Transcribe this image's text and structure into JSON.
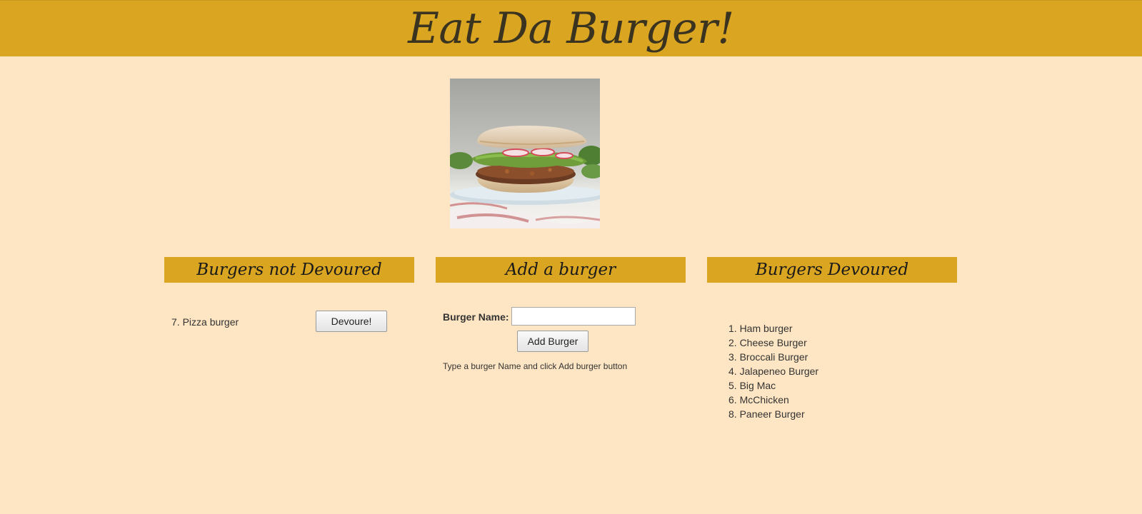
{
  "header": {
    "title": "Eat Da Burger!"
  },
  "hero": {
    "image_icon": "burger-photo"
  },
  "columns": {
    "not_devoured": {
      "title": "Burgers not Devoured",
      "items": [
        {
          "label": "7. Pizza burger",
          "button_label": "Devoure!"
        }
      ]
    },
    "add": {
      "title": "Add a burger",
      "field_label": "Burger Name:",
      "field_value": "",
      "field_placeholder": "",
      "button_label": "Add Burger",
      "hint": "Type a burger Name and click Add burger button"
    },
    "devoured": {
      "title": "Burgers Devoured",
      "items": [
        "1. Ham burger",
        "2. Cheese Burger",
        "3. Broccali Burger",
        "4. Jalapeneo Burger",
        "5. Big Mac",
        "6. McChicken",
        "8. Paneer Burger"
      ]
    }
  },
  "colors": {
    "background": "#fee5c3",
    "header": "#daa520",
    "title_text": "#3a3320"
  }
}
